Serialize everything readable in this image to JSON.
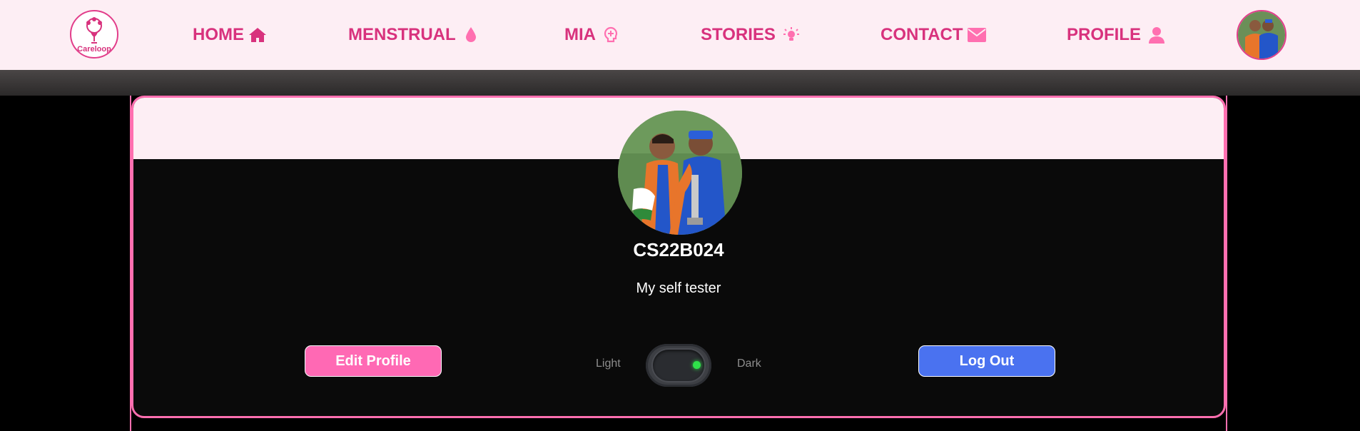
{
  "nav": {
    "logo_text": "Careloop",
    "items": [
      {
        "label": "HOME",
        "icon": "home-icon"
      },
      {
        "label": "MENSTRUAL",
        "icon": "drop-icon"
      },
      {
        "label": "MIA",
        "icon": "brain-icon"
      },
      {
        "label": "STORIES",
        "icon": "lightbulb-icon"
      },
      {
        "label": "CONTACT",
        "icon": "envelope-icon"
      },
      {
        "label": "PROFILE",
        "icon": "user-icon"
      }
    ]
  },
  "profile": {
    "username": "CS22B024",
    "bio": "My self tester",
    "edit_label": "Edit Profile",
    "logout_label": "Log Out",
    "theme_light_label": "Light",
    "theme_dark_label": "Dark",
    "theme_state": "dark"
  },
  "colors": {
    "brand_pink": "#d8327d",
    "nav_bg": "#fdeef4",
    "edit_button": "#ff69b4",
    "logout_button": "#4a72f0",
    "toggle_indicator": "#2fe24a"
  }
}
